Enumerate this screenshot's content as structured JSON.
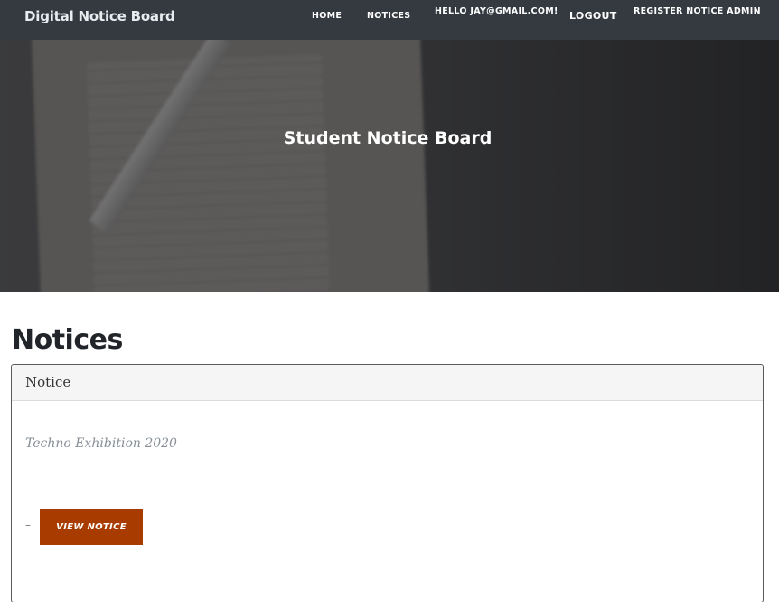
{
  "navbar": {
    "brand": "Digital Notice Board",
    "links": {
      "home": "HOME",
      "notices": "NOTICES",
      "hello": "HELLO JAY@GMAIL.COM!",
      "logout": "LOGOUT",
      "register": "REGISTER NOTICE ADMIN"
    }
  },
  "hero": {
    "title": "Student Notice Board"
  },
  "main": {
    "title": "Notices",
    "card": {
      "header": "Notice",
      "notice_title": "Techno Exhibition 2020",
      "separator": "–",
      "button_label": "VIEW NOTICE"
    }
  },
  "colors": {
    "navbar_bg": "#343a40",
    "button_bg": "#a83c00"
  }
}
